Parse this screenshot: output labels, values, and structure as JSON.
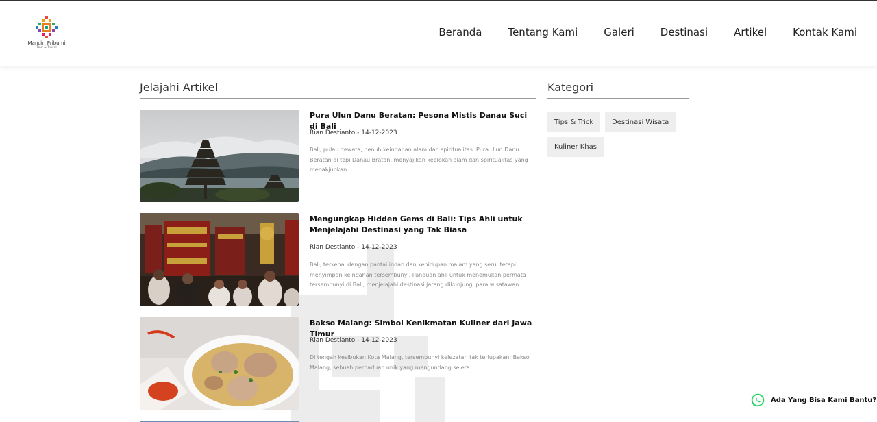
{
  "header": {
    "logo": {
      "name": "Mandiri Pribumi",
      "tagline": "Tour & Travel"
    },
    "nav": [
      "Beranda",
      "Tentang Kami",
      "Galeri",
      "Destinasi",
      "Artikel",
      "Kontak Kami"
    ]
  },
  "main": {
    "title": "Jelajahi Artikel",
    "articles": [
      {
        "title": "Pura Ulun Danu Beratan: Pesona Mistis Danau Suci di Bali",
        "meta": "Rian Destianto - 14-12-2023",
        "excerpt": "Bali, pulau dewata, penuh keindahan alam dan spiritualitas. Pura Ulun Danu Beratan di tepi Danau Bratan, menyajikan keelokan alam dan spiritualitas yang menakjubkan."
      },
      {
        "title": "Mengungkap Hidden Gems di Bali: Tips Ahli untuk Menjelajahi Destinasi yang Tak Biasa",
        "meta": "Rian Destianto - 14-12-2023",
        "excerpt": "Bali, terkenal dengan pantai indah dan kehidupan malam yang seru, tetapi menyimpan keindahan tersembunyi. Panduan ahli untuk menemukan permata tersembunyi di Bali, menjelajahi destinasi jarang dikunjungi para wisatawan."
      },
      {
        "title": "Bakso Malang: Simbol Kenikmatan Kuliner dari Jawa Timur",
        "meta": "Rian Destianto - 14-12-2023",
        "excerpt": "Di tengah kesibukan Kota Malang, tersembunyi kelezatan tak terlupakan: Bakso Malang, sebuah perpaduan unik yang mengundang selera."
      }
    ]
  },
  "sidebar": {
    "title": "Kategori",
    "categories": [
      "Tips & Trick",
      "Destinasi Wisata",
      "Kuliner Khas"
    ]
  },
  "help": {
    "label": "Ada Yang Bisa Kami Bantu?"
  },
  "colors": {
    "whatsapp": "#25D366",
    "chip_bg": "#eeeeee"
  }
}
